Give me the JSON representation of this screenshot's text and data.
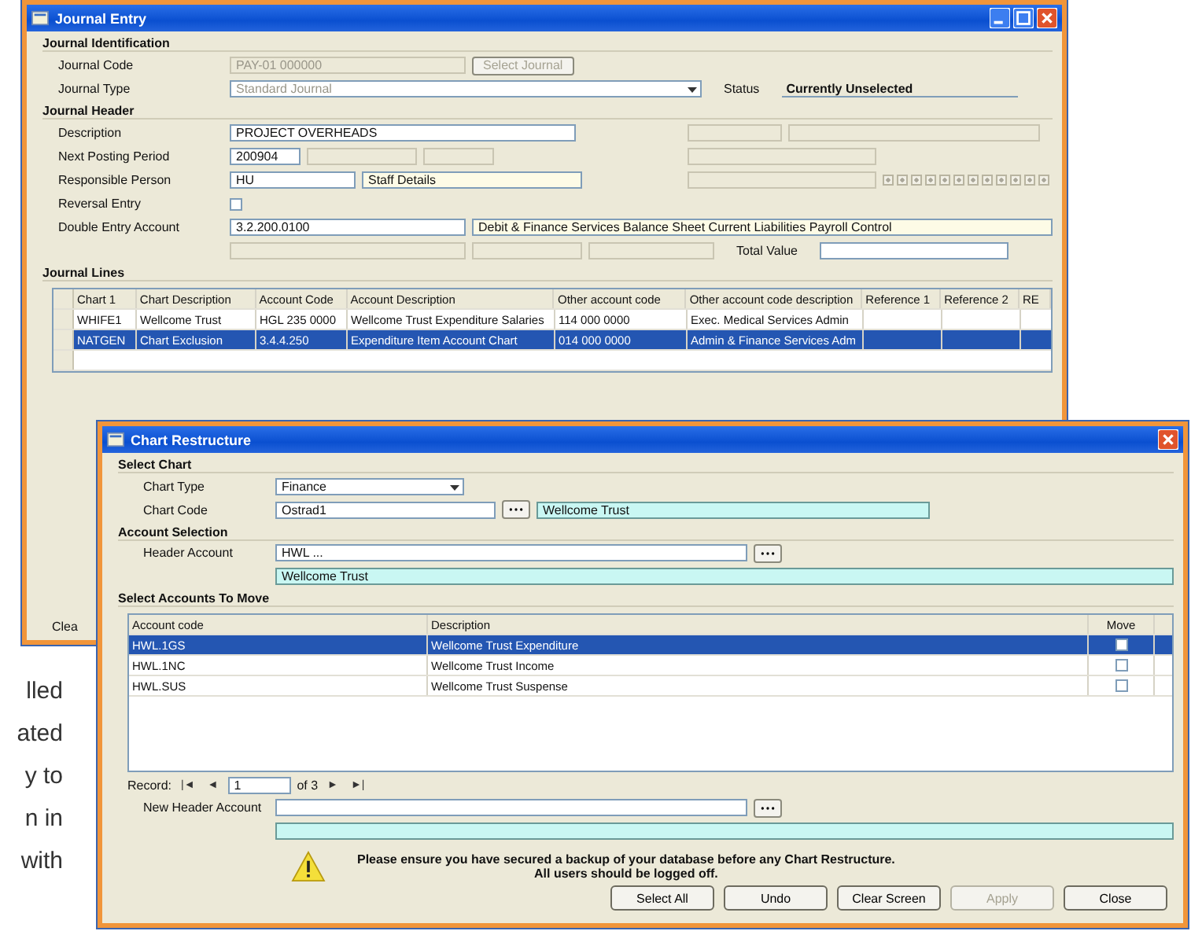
{
  "page_text": [
    "lled",
    "ated",
    "y to",
    "n in",
    "with"
  ],
  "journal_window": {
    "title": "Journal Entry",
    "identification": {
      "heading": "Journal Identification",
      "code_label": "Journal Code",
      "code_value": "PAY-01 000000",
      "code_button": "Select Journal",
      "type_label": "Journal Type",
      "type_value": "Standard Journal",
      "status_label": "Status",
      "status_value": "Currently Unselected"
    },
    "header": {
      "heading": "Journal Header",
      "description_label": "Description",
      "description_value": "PROJECT OVERHEADS",
      "period_label": "Next Posting Period",
      "period_value": "200904",
      "person_label": "Responsible Person",
      "person_value": "HU",
      "person_details": "Staff Details",
      "reversal_label": "Reversal Entry",
      "reversal_checked": false,
      "double_label": "Double Entry Account",
      "double_value": "3.2.200.0100",
      "double_description": "Debit & Finance Services Balance Sheet Current Liabilities Payroll Control",
      "period_flags": [
        true,
        true,
        true,
        true,
        true,
        true,
        true,
        true,
        true,
        true,
        true,
        true
      ],
      "total_label": "Total Value"
    },
    "lines": {
      "heading": "Journal Lines",
      "columns": [
        "Chart 1",
        "Chart Description",
        "Account Code",
        "Account Description",
        "Other account code",
        "Other account code description",
        "Reference 1",
        "Reference 2",
        "RE"
      ],
      "rows": [
        {
          "cells": [
            "WHIFE1",
            "Wellcome Trust",
            "HGL 235 0000",
            "Wellcome Trust Expenditure Salaries",
            "114 000 0000",
            "Exec. Medical Services Admin",
            "",
            ""
          ],
          "selected": false
        },
        {
          "cells": [
            "NATGEN",
            "Chart Exclusion",
            "3.4.4.250",
            "Expenditure Item Account Chart",
            "014 000 0000",
            "Admin & Finance Services Adm",
            "",
            ""
          ],
          "selected": true
        }
      ]
    },
    "footer_text": "Clea"
  },
  "chart_window": {
    "title": "Chart Restructure",
    "select_chart": {
      "heading": "Select Chart",
      "type_label": "Chart Type",
      "type_value": "Finance",
      "code_label": "Chart Code",
      "code_value": "Ostrad1",
      "code_name": "Wellcome Trust"
    },
    "account_selection": {
      "heading": "Account Selection",
      "header_label": "Header Account",
      "header_value": "HWL ...",
      "header_name": "Wellcome Trust"
    },
    "accounts": {
      "heading": "Select Accounts To Move",
      "columns": [
        "Account code",
        "Description",
        "Move"
      ],
      "rows": [
        {
          "code": "HWL.1GS",
          "description": "Wellcome Trust Expenditure",
          "move": false,
          "selected": true
        },
        {
          "code": "HWL.1NC",
          "description": "Wellcome Trust Income",
          "move": false,
          "selected": false
        },
        {
          "code": "HWL.SUS",
          "description": "Wellcome Trust Suspense",
          "move": false,
          "selected": false
        }
      ]
    },
    "record": {
      "label": "Record:",
      "first": "|◄",
      "prev": "◄",
      "current": "1",
      "of": "of 3",
      "next": "►",
      "last": "►|"
    },
    "new_header_label": "New Header Account",
    "warning": [
      "Please ensure you have secured a backup of your database before any Chart Restructure.",
      "All users should be logged off."
    ],
    "buttons": [
      {
        "label": "Select All",
        "disabled": false
      },
      {
        "label": "Undo",
        "disabled": false
      },
      {
        "label": "Clear Screen",
        "disabled": false
      },
      {
        "label": "Apply",
        "disabled": true
      },
      {
        "label": "Close",
        "disabled": false
      }
    ]
  }
}
